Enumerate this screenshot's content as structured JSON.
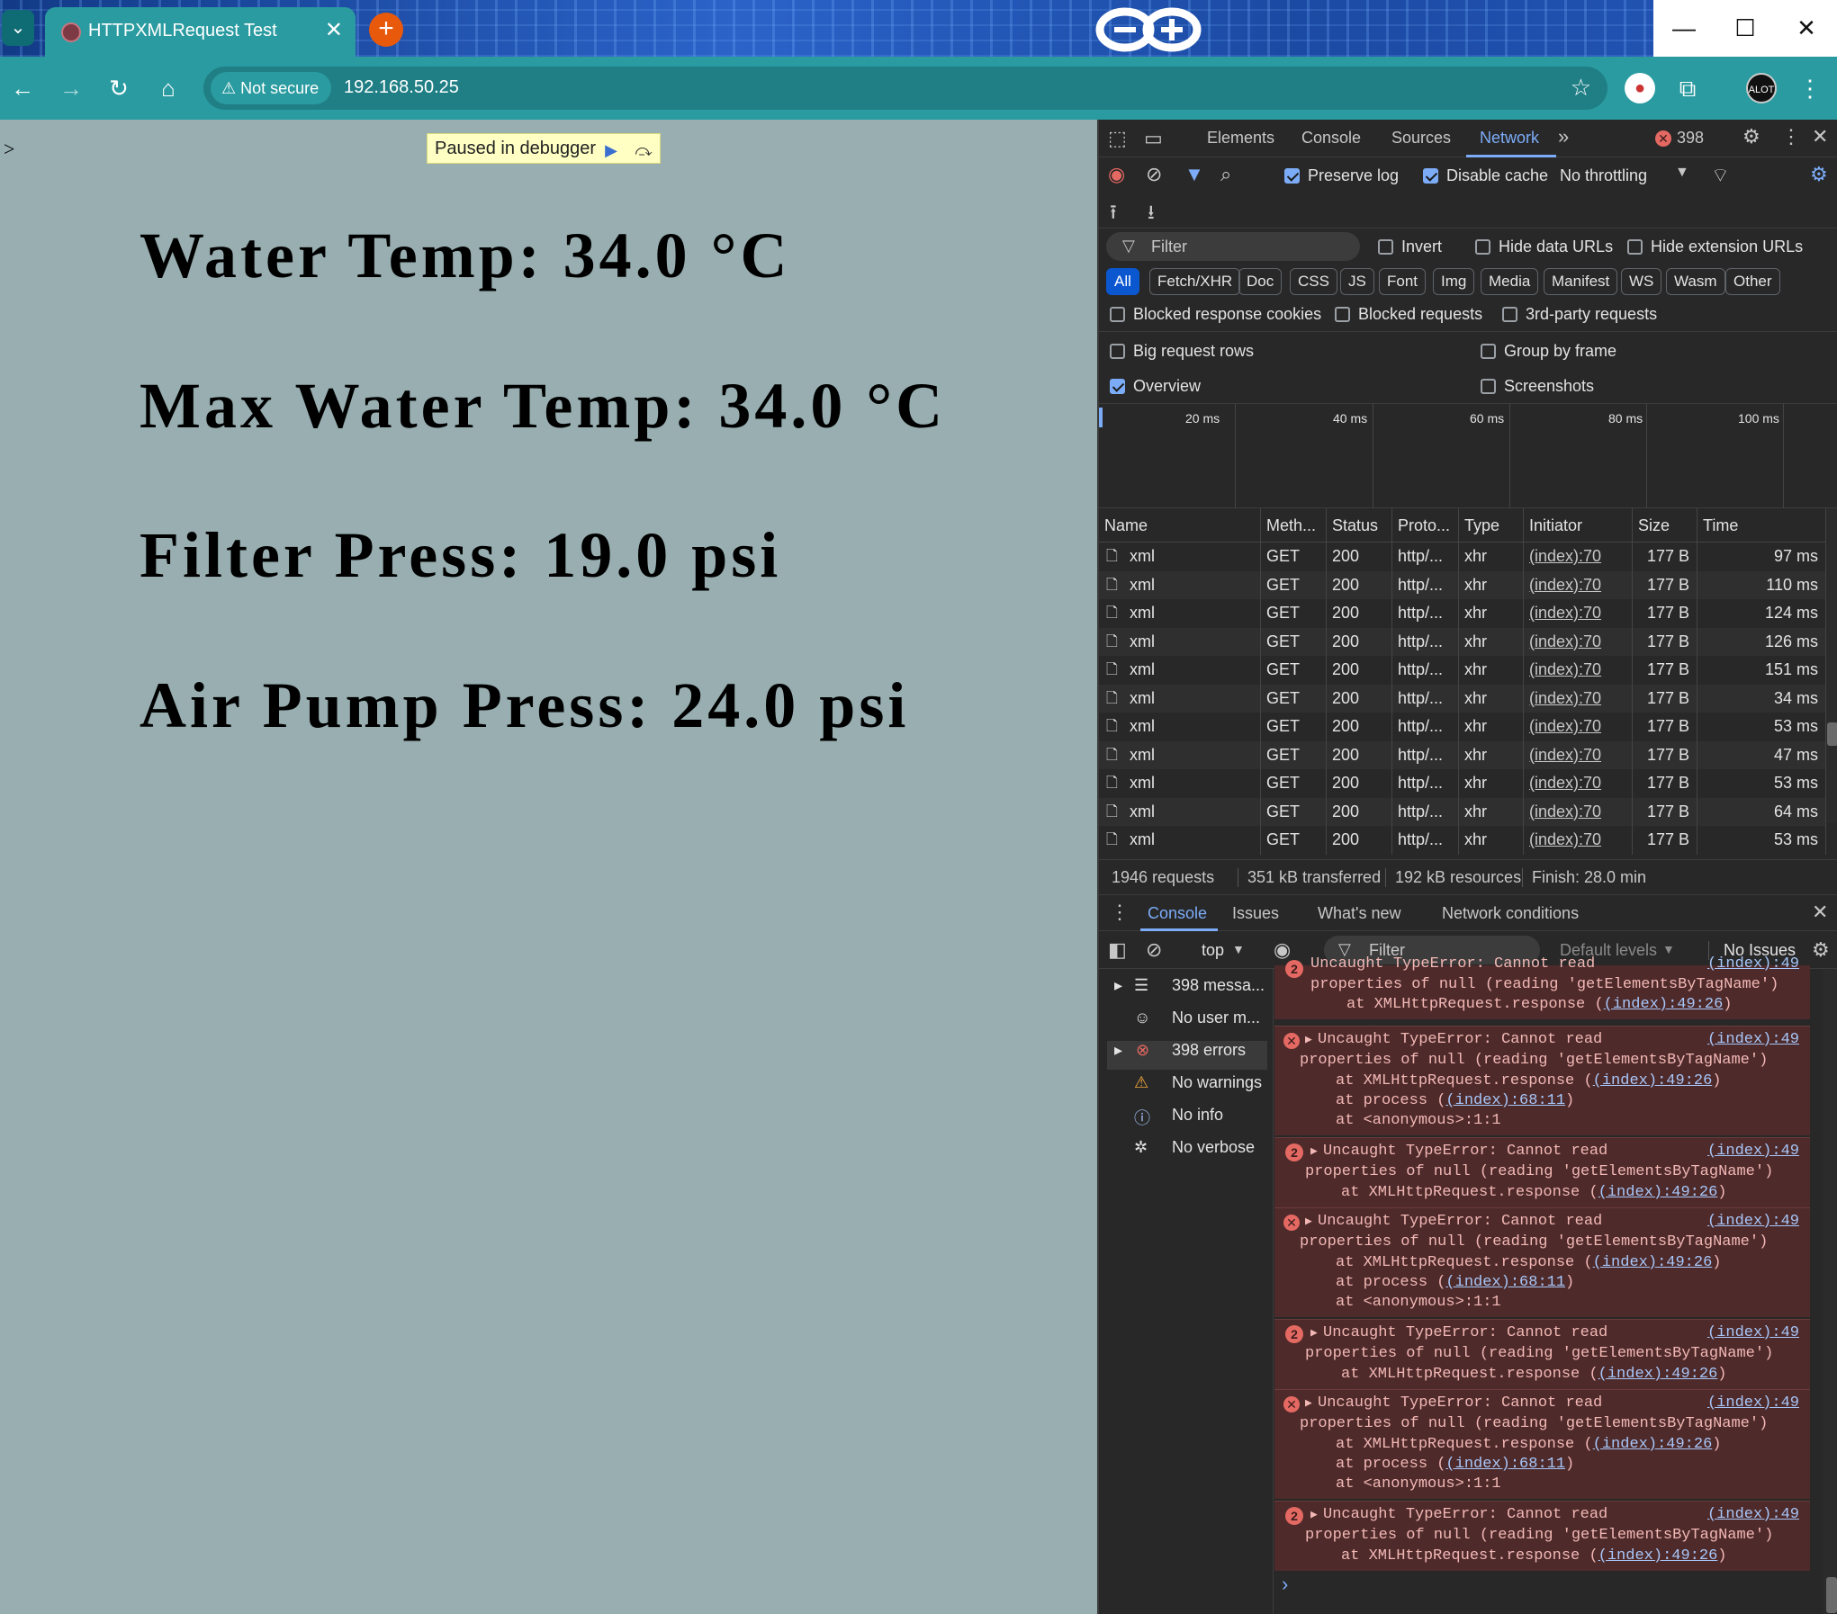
{
  "browser": {
    "tab_title": "HTTPXMLRequest Test",
    "tab_close": "✕",
    "new_tab": "+",
    "security_label": "Not secure",
    "url": "192.168.50.25",
    "profile": "ALOT"
  },
  "page": {
    "caret": ">",
    "debugger_banner": "Paused in debugger",
    "readings": [
      "Water Temp: 34.0 °C",
      "Max Water Temp: 34.0 °C",
      "Filter Press: 19.0 psi",
      "Air Pump Press: 24.0 psi"
    ]
  },
  "devtools": {
    "tabs": [
      "Elements",
      "Console",
      "Sources",
      "Network"
    ],
    "error_count": "398",
    "preserve_log": "Preserve log",
    "disable_cache": "Disable cache",
    "throttling": "No throttling",
    "filter_placeholder": "Filter",
    "invert": "Invert",
    "hide_data_urls": "Hide data URLs",
    "hide_extension_urls": "Hide extension URLs",
    "type_filters": [
      "All",
      "Fetch/XHR",
      "Doc",
      "CSS",
      "JS",
      "Font",
      "Img",
      "Media",
      "Manifest",
      "WS",
      "Wasm",
      "Other"
    ],
    "blocked_cookies": "Blocked response cookies",
    "blocked_requests": "Blocked requests",
    "third_party": "3rd-party requests",
    "big_rows": "Big request rows",
    "group_by_frame": "Group by frame",
    "overview": "Overview",
    "screenshots": "Screenshots",
    "timeline_ticks": [
      "20 ms",
      "40 ms",
      "60 ms",
      "80 ms",
      "100 ms"
    ],
    "columns": [
      "Name",
      "Meth...",
      "Status",
      "Proto...",
      "Type",
      "Initiator",
      "Size",
      "Time"
    ],
    "rows": [
      {
        "name": "xml",
        "method": "GET",
        "status": "200",
        "proto": "http/...",
        "type": "xhr",
        "initiator": "(index):70",
        "size": "177 B",
        "time": "97 ms"
      },
      {
        "name": "xml",
        "method": "GET",
        "status": "200",
        "proto": "http/...",
        "type": "xhr",
        "initiator": "(index):70",
        "size": "177 B",
        "time": "110 ms"
      },
      {
        "name": "xml",
        "method": "GET",
        "status": "200",
        "proto": "http/...",
        "type": "xhr",
        "initiator": "(index):70",
        "size": "177 B",
        "time": "124 ms"
      },
      {
        "name": "xml",
        "method": "GET",
        "status": "200",
        "proto": "http/...",
        "type": "xhr",
        "initiator": "(index):70",
        "size": "177 B",
        "time": "126 ms"
      },
      {
        "name": "xml",
        "method": "GET",
        "status": "200",
        "proto": "http/...",
        "type": "xhr",
        "initiator": "(index):70",
        "size": "177 B",
        "time": "151 ms"
      },
      {
        "name": "xml",
        "method": "GET",
        "status": "200",
        "proto": "http/...",
        "type": "xhr",
        "initiator": "(index):70",
        "size": "177 B",
        "time": "34 ms"
      },
      {
        "name": "xml",
        "method": "GET",
        "status": "200",
        "proto": "http/...",
        "type": "xhr",
        "initiator": "(index):70",
        "size": "177 B",
        "time": "53 ms"
      },
      {
        "name": "xml",
        "method": "GET",
        "status": "200",
        "proto": "http/...",
        "type": "xhr",
        "initiator": "(index):70",
        "size": "177 B",
        "time": "47 ms"
      },
      {
        "name": "xml",
        "method": "GET",
        "status": "200",
        "proto": "http/...",
        "type": "xhr",
        "initiator": "(index):70",
        "size": "177 B",
        "time": "53 ms"
      },
      {
        "name": "xml",
        "method": "GET",
        "status": "200",
        "proto": "http/...",
        "type": "xhr",
        "initiator": "(index):70",
        "size": "177 B",
        "time": "64 ms"
      },
      {
        "name": "xml",
        "method": "GET",
        "status": "200",
        "proto": "http/...",
        "type": "xhr",
        "initiator": "(index):70",
        "size": "177 B",
        "time": "53 ms"
      }
    ],
    "summary": [
      "1946 requests",
      "351 kB transferred",
      "192 kB resources",
      "Finish: 28.0 min"
    ],
    "drawer_tabs": [
      "Console",
      "Issues",
      "What's new",
      "Network conditions"
    ],
    "context": "top",
    "console_filter": "Filter",
    "levels": "Default levels",
    "issues": "No Issues",
    "sidebar": [
      "398 messa...",
      "No user m...",
      "398 errors",
      "No warnings",
      "No info",
      "No verbose"
    ],
    "err_line1": "Uncaught TypeError: Cannot read",
    "err_line2": "properties of null (reading 'getElementsByTagName')",
    "err_line3_pre": "at XMLHttpRequest.response (",
    "err_line3_link": "(index):49:26",
    "err_line3_post": ")",
    "err_line4_pre": "at process (",
    "err_line4_link": "(index):68:11",
    "err_line4_post": ")",
    "err_line5": "at <anonymous>:1:1",
    "err_source": "(index):49",
    "err_group_count": "2",
    "err_top_partial": "Uncaught TypeError: Cannot read",
    "err_top_source": "(index):49",
    "prompt": "›"
  },
  "colors": {
    "accent": "#2a9ba0",
    "page_bg": "#98aeb0",
    "devtools_bg": "#282828",
    "error_bg": "#4e2a2a"
  }
}
